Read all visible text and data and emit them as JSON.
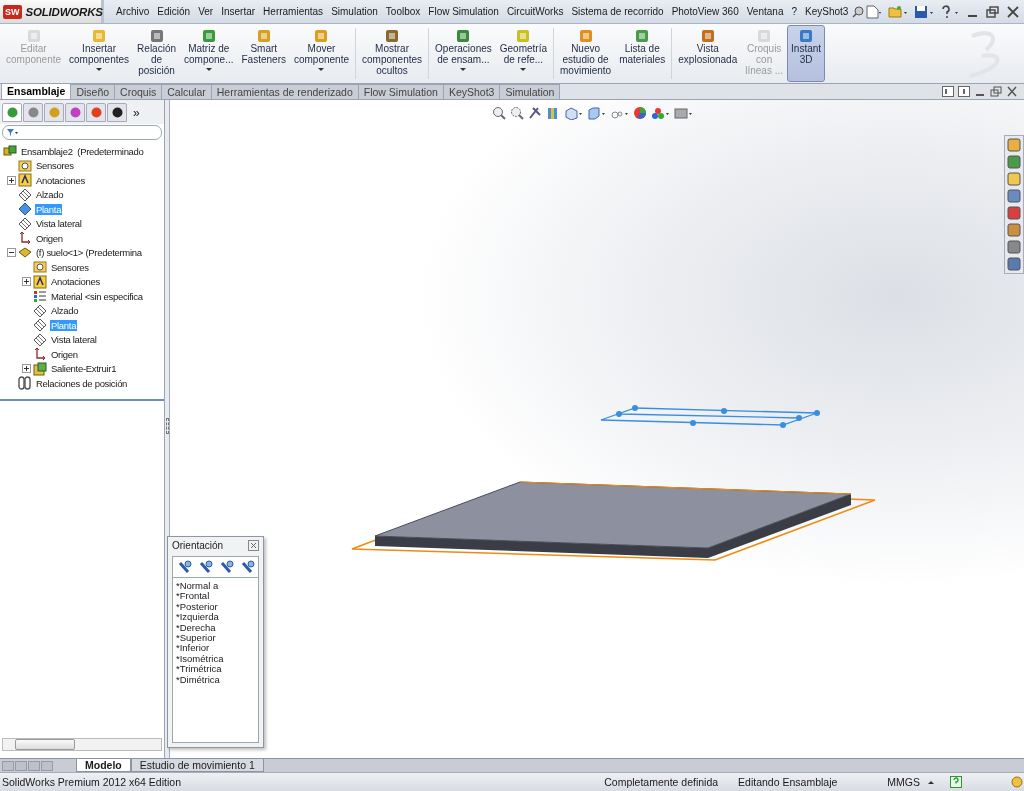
{
  "app": {
    "logo_mark": "SW",
    "logo": "SOLIDWORKS"
  },
  "menu": [
    "Archivo",
    "Edición",
    "Ver",
    "Insertar",
    "Herramientas",
    "Simulation",
    "Toolbox",
    "Flow Simulation",
    "CircuitWorks",
    "Sistema de recorrido",
    "PhotoView 360",
    "Ventana",
    "?",
    "KeyShot3"
  ],
  "ribbon": [
    {
      "label": "Editar\ncomponente",
      "disabled": true,
      "dropdown": false,
      "selected": false
    },
    {
      "label": "Insertar\ncomponentes",
      "disabled": false,
      "dropdown": true,
      "selected": false
    },
    {
      "label": "Relación\nde\nposición",
      "disabled": false,
      "dropdown": false,
      "selected": false
    },
    {
      "label": "Matriz de\ncompone...",
      "disabled": false,
      "dropdown": true,
      "selected": false
    },
    {
      "label": "Smart\nFasteners",
      "disabled": false,
      "dropdown": false,
      "selected": false
    },
    {
      "label": "Mover\ncomponente",
      "disabled": false,
      "dropdown": true,
      "selected": false
    },
    {
      "label": "Mostrar\ncomponentes\nocultos",
      "disabled": false,
      "dropdown": false,
      "selected": false
    },
    {
      "label": "Operaciones\nde ensam...",
      "disabled": false,
      "dropdown": true,
      "selected": false
    },
    {
      "label": "Geometría\nde refe...",
      "disabled": false,
      "dropdown": true,
      "selected": false
    },
    {
      "label": "Nuevo\nestudio de\nmovimiento",
      "disabled": false,
      "dropdown": false,
      "selected": false
    },
    {
      "label": "Lista de\nmateriales",
      "disabled": false,
      "dropdown": false,
      "selected": false
    },
    {
      "label": "Vista\nexplosionada",
      "disabled": false,
      "dropdown": false,
      "selected": false
    },
    {
      "label": "Croquis\ncon\nlíneas ...",
      "disabled": true,
      "dropdown": false,
      "selected": false
    },
    {
      "label": "Instant\n3D",
      "disabled": false,
      "dropdown": false,
      "selected": true
    }
  ],
  "tabs": [
    {
      "label": "Ensamblaje",
      "selected": true
    },
    {
      "label": "Diseño",
      "selected": false
    },
    {
      "label": "Croquis",
      "selected": false
    },
    {
      "label": "Calcular",
      "selected": false
    },
    {
      "label": "Herramientas de renderizado",
      "selected": false
    },
    {
      "label": "Flow Simulation",
      "selected": false
    },
    {
      "label": "KeyShot3",
      "selected": false
    },
    {
      "label": "Simulation",
      "selected": false
    }
  ],
  "panel_tabs": {
    "items": [
      {
        "selected": true
      },
      {
        "selected": false
      },
      {
        "selected": false
      },
      {
        "selected": false
      },
      {
        "selected": false
      },
      {
        "selected": false
      }
    ],
    "more": "»"
  },
  "tree": [
    {
      "label": "Ensamblaje2  (Predeterminado",
      "kind": "assembly",
      "selected": false,
      "children": [
        {
          "label": "Sensores",
          "kind": "sensors",
          "selected": false
        },
        {
          "label": "Anotaciones",
          "kind": "annotations",
          "selected": false,
          "expanded": false
        },
        {
          "label": "Alzado",
          "kind": "plane",
          "selected": false
        },
        {
          "label": "Planta",
          "kind": "plane",
          "selected": true
        },
        {
          "label": "Vista lateral",
          "kind": "plane",
          "selected": false
        },
        {
          "label": "Origen",
          "kind": "origin",
          "selected": false
        },
        {
          "label": "(f) suelo<1> (Predetermina",
          "kind": "part",
          "selected": false,
          "expanded": true,
          "children": [
            {
              "label": "Sensores",
              "kind": "sensors",
              "selected": false
            },
            {
              "label": "Anotaciones",
              "kind": "annotations",
              "selected": false,
              "expanded": false
            },
            {
              "label": "Material <sin especifica",
              "kind": "material",
              "selected": false
            },
            {
              "label": "Alzado",
              "kind": "plane",
              "selected": false
            },
            {
              "label": "Planta",
              "kind": "plane",
              "selected": true
            },
            {
              "label": "Vista lateral",
              "kind": "plane",
              "selected": false
            },
            {
              "label": "Origen",
              "kind": "origin",
              "selected": false
            },
            {
              "label": "Saliente-Extruir1",
              "kind": "feature",
              "selected": false,
              "expanded": false
            }
          ]
        },
        {
          "label": "Relaciones de posición",
          "kind": "mates",
          "selected": false
        }
      ]
    }
  ],
  "orientation": {
    "title": "Orientación",
    "views": [
      "*Normal a",
      "*Frontal",
      "*Posterior",
      "*Izquierda",
      "*Derecha",
      "*Superior",
      "*Inferior",
      "*Isométrica",
      "*Trimétrica",
      "*Dimétrica"
    ]
  },
  "bottom_tabs": [
    {
      "label": "Modelo",
      "selected": true
    },
    {
      "label": "Estudio de movimiento 1",
      "selected": false
    }
  ],
  "status_bar": {
    "product": "SolidWorks Premium 2012 x64 Edition",
    "definition": "Completamente definida",
    "mode": "Editando Ensamblaje",
    "units": "MMGS"
  }
}
